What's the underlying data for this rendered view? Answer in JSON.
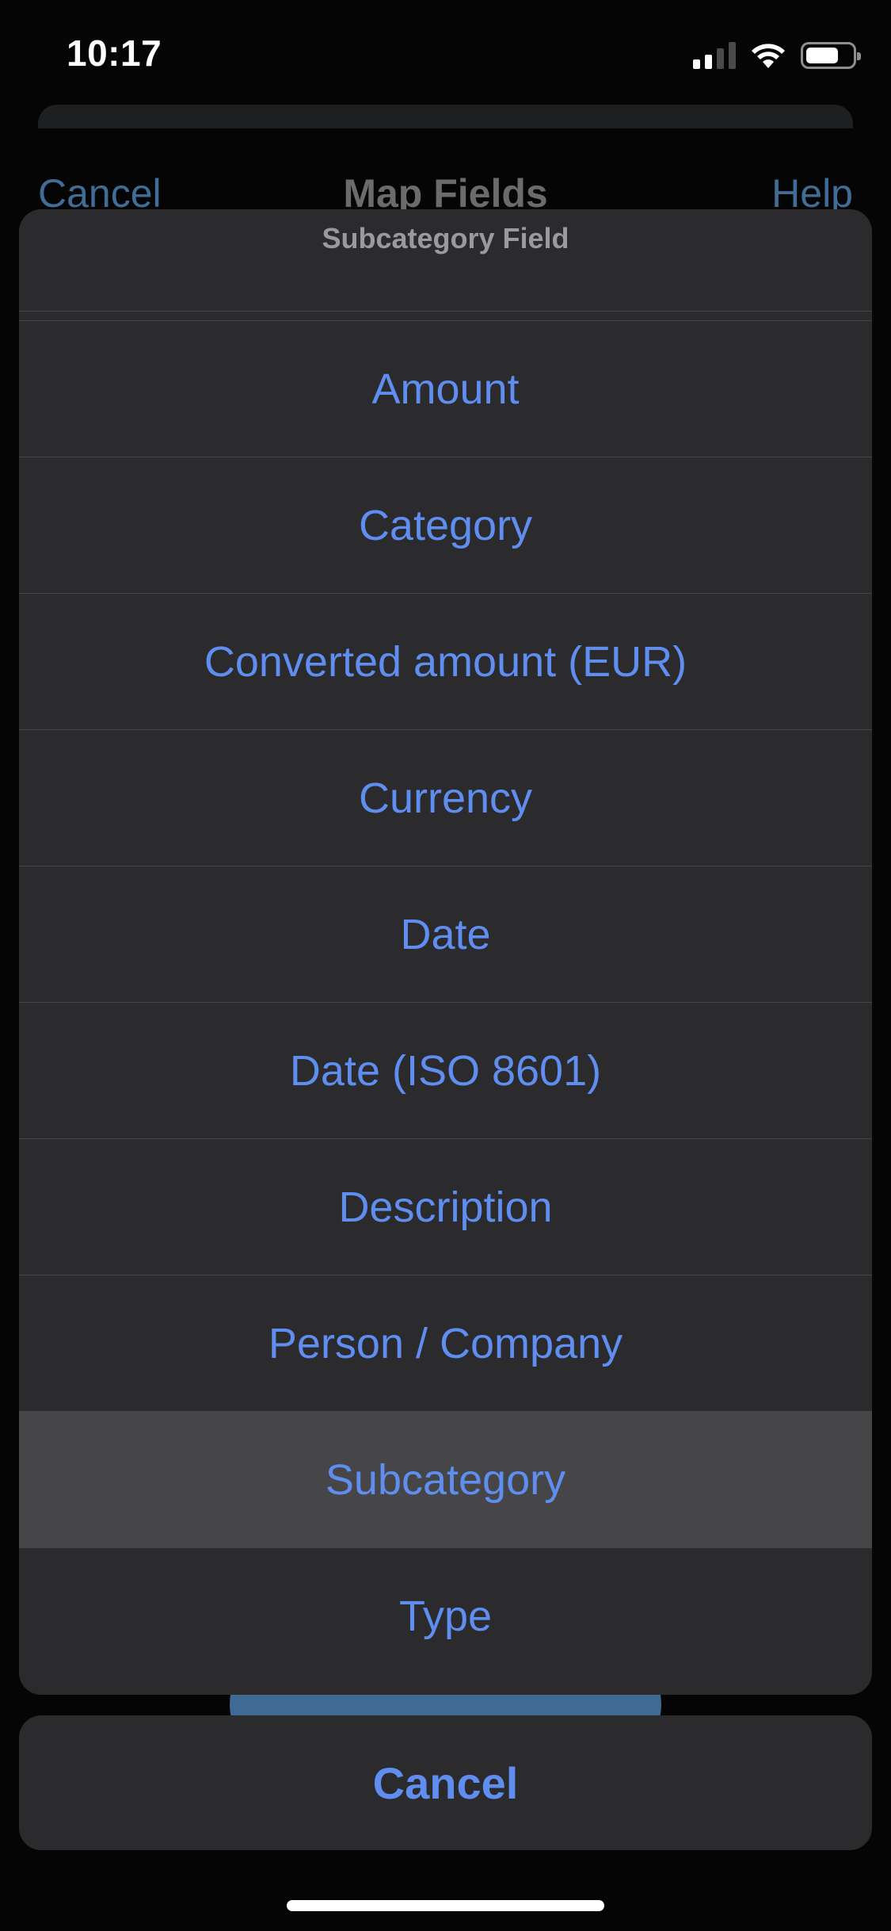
{
  "status_bar": {
    "time": "10:17",
    "icons": [
      "cellular-signal-icon",
      "wifi-icon",
      "battery-icon"
    ]
  },
  "background": {
    "nav": {
      "cancel_label": "Cancel",
      "title": "Map Fields",
      "help_label": "Help"
    }
  },
  "action_sheet": {
    "title": "Subcategory Field",
    "options": [
      "Amount",
      "Category",
      "Converted amount (EUR)",
      "Currency",
      "Date",
      "Date (ISO 8601)",
      "Description",
      "Person / Company",
      "Subcategory",
      "Type"
    ],
    "highlighted_option": "Subcategory",
    "cancel_label": "Cancel"
  },
  "colors": {
    "accent": "#5f8ef0",
    "sheet_background": "#2b2b2d",
    "highlight_background": "#464648"
  }
}
